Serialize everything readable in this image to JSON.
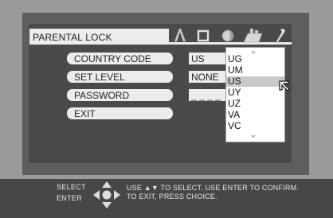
{
  "menu": {
    "title": "PARENTAL LOCK",
    "icons": [
      "audio-icon",
      "display-icon",
      "language-icon",
      "features-icon",
      "setup-icon"
    ],
    "rows": [
      {
        "label": "COUNTRY CODE",
        "value": "US"
      },
      {
        "label": "SET LEVEL",
        "value": "NONE"
      },
      {
        "label": "PASSWORD",
        "value": "_ _ _ _"
      },
      {
        "label": "EXIT"
      }
    ]
  },
  "dropdown": {
    "items": [
      "UG",
      "UM",
      "US",
      "UY",
      "UZ",
      "VA",
      "VC"
    ],
    "selected": "US"
  },
  "footer": {
    "select_label": "SELECT",
    "enter_label": "ENTER",
    "help_line1": "USE ▲▼ TO SELECT.  USE ENTER TO CONFIRM.",
    "help_line2": "TO EXIT, PRESS CHOICE."
  }
}
